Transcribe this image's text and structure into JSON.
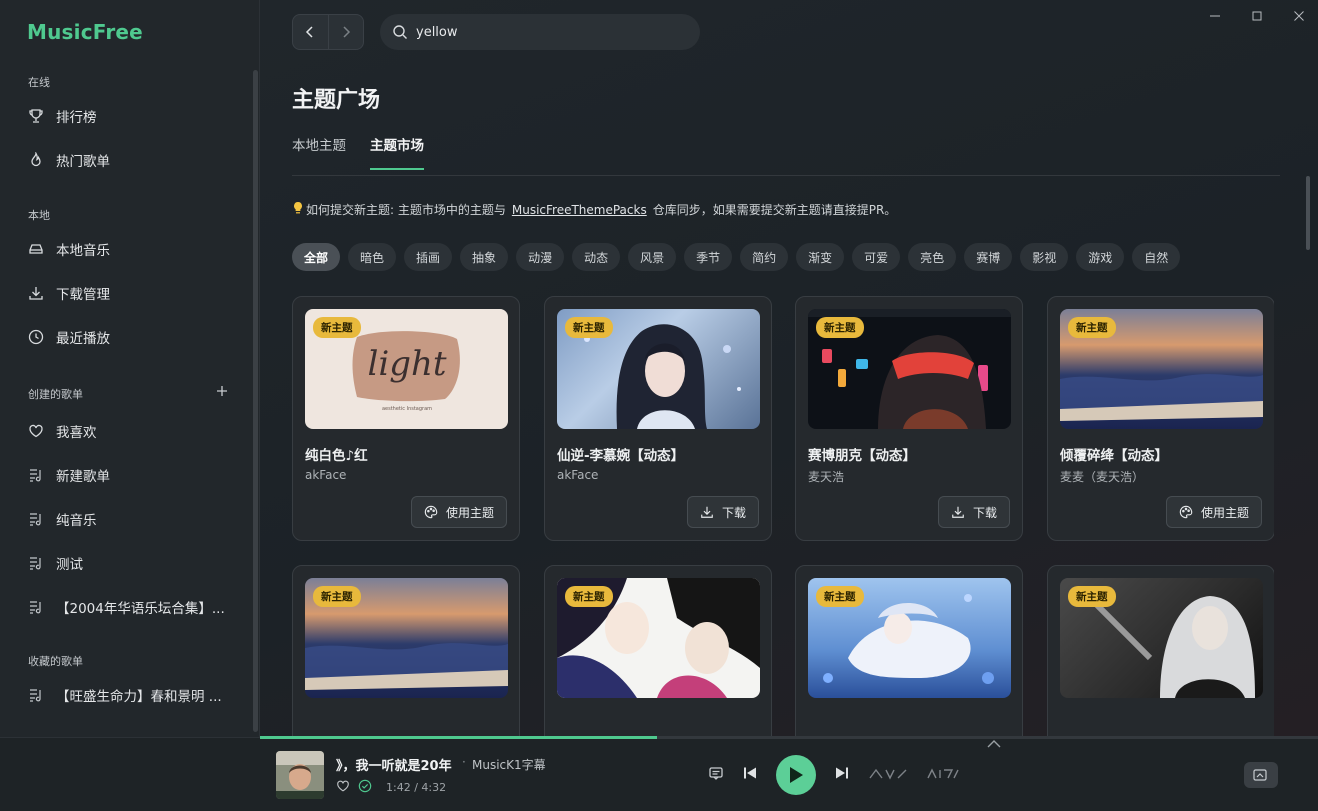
{
  "app": {
    "name": "MusicFree"
  },
  "sidebar": {
    "online_label": "在线",
    "online_items": [
      {
        "label": "排行榜",
        "icon": "trophy-icon"
      },
      {
        "label": "热门歌单",
        "icon": "fire-icon"
      }
    ],
    "local_label": "本地",
    "local_items": [
      {
        "label": "本地音乐",
        "icon": "drive-icon"
      },
      {
        "label": "下载管理",
        "icon": "download-icon"
      },
      {
        "label": "最近播放",
        "icon": "clock-icon"
      }
    ],
    "created_label": "创建的歌单",
    "created_items": [
      {
        "label": "我喜欢",
        "icon": "heart-icon"
      },
      {
        "label": "新建歌单",
        "icon": "playlist-icon"
      },
      {
        "label": "纯音乐",
        "icon": "playlist-icon"
      },
      {
        "label": "测试",
        "icon": "playlist-icon"
      },
      {
        "label": "【2004年华语乐坛合集】...",
        "icon": "playlist-icon"
      }
    ],
    "collected_label": "收藏的歌单",
    "collected_items": [
      {
        "label": "【旺盛生命力】春和景明 ...",
        "icon": "playlist-icon"
      }
    ],
    "bottom_icons": [
      "apps-icon",
      "palette-icon",
      "settings-icon",
      "minimode-icon"
    ]
  },
  "search": {
    "value": "yellow"
  },
  "page": {
    "title": "主题广场",
    "tabs": [
      {
        "label": "本地主题",
        "active": false
      },
      {
        "label": "主题市场",
        "active": true
      }
    ],
    "hint_before": "如何提交新主题: 主题市场中的主题与",
    "hint_link": "MusicFreeThemePacks",
    "hint_after": "仓库同步，如果需要提交新主题请直接提PR。",
    "categories": [
      "全部",
      "暗色",
      "插画",
      "抽象",
      "动漫",
      "动态",
      "风景",
      "季节",
      "简约",
      "渐变",
      "可爱",
      "亮色",
      "赛博",
      "影视",
      "游戏",
      "自然"
    ],
    "active_category": "全部"
  },
  "themes": [
    {
      "badge": "新主题",
      "title": "纯白色♪红",
      "author": "akFace",
      "button": "使用主题",
      "button_icon": "palette-icon",
      "thumb_text": "light",
      "thumb_sub": "aesthetic Instagram"
    },
    {
      "badge": "新主题",
      "title": "仙逆-李慕婉【动态】",
      "author": "akFace",
      "button": "下载",
      "button_icon": "download-icon"
    },
    {
      "badge": "新主题",
      "title": "赛博朋克【动态】",
      "author": "麦天浩",
      "button": "下载",
      "button_icon": "download-icon"
    },
    {
      "badge": "新主题",
      "title": "倾覆碎绛【动态】",
      "author": "麦麦（麦天浩）",
      "button": "使用主题",
      "button_icon": "palette-icon"
    },
    {
      "badge": "新主题",
      "title": "",
      "author": "",
      "button": ""
    },
    {
      "badge": "新主题",
      "title": "",
      "author": "",
      "button": ""
    },
    {
      "badge": "新主题",
      "title": "",
      "author": "",
      "button": ""
    },
    {
      "badge": "新主题",
      "title": "",
      "author": "",
      "button": ""
    }
  ],
  "player": {
    "title": "》，我一听就是20年",
    "separator": "·",
    "artist": "MusicK1字幕",
    "time": "1:42 / 4:32",
    "progress": 0.375,
    "accent": "#4fc98f"
  }
}
